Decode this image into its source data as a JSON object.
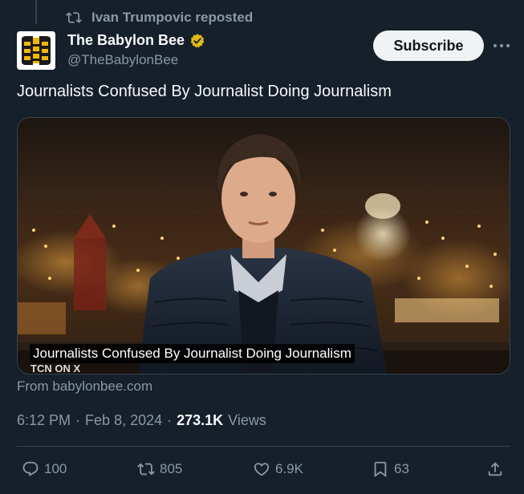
{
  "repost": {
    "text": "Ivan Trumpovic reposted"
  },
  "author": {
    "display_name": "The Babylon Bee",
    "handle": "@TheBabylonBee"
  },
  "header": {
    "subscribe_label": "Subscribe"
  },
  "tweet": {
    "text": "Journalists Confused By Journalist Doing Journalism"
  },
  "media": {
    "caption": "Journalists Confused By Journalist Doing Journalism",
    "watermark": "TCN ON X"
  },
  "source": {
    "text": "From babylonbee.com"
  },
  "meta": {
    "time": "6:12 PM",
    "date": "Feb 8, 2024",
    "views_count": "273.1K",
    "views_label": "Views"
  },
  "actions": {
    "replies": "100",
    "reposts": "805",
    "likes": "6.9K",
    "bookmarks": "63"
  },
  "colors": {
    "background": "#15202b",
    "secondary_text": "#8b98a5",
    "verified_gold": "#e2b719",
    "divider": "#38444d"
  }
}
